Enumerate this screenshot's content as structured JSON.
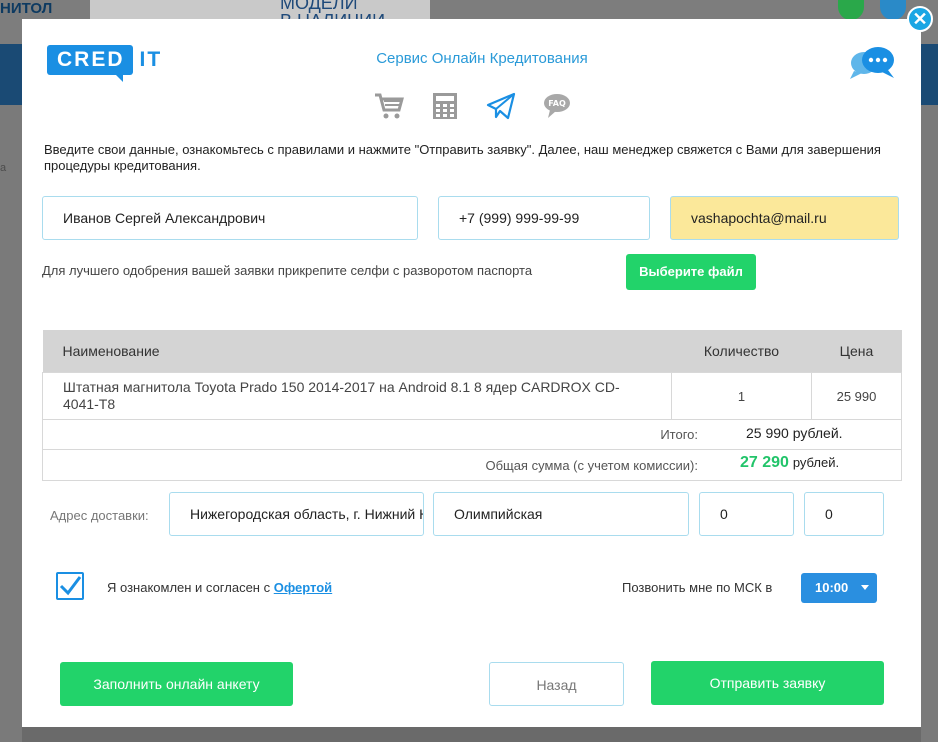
{
  "background": {
    "left_text": "НИТОЛ",
    "banner_text_line1": "МОДЕЛИ",
    "banner_text_line2": "В НАЛИЧИИ",
    "side_text": "а"
  },
  "modal": {
    "logo_part1": "CRED",
    "logo_part2": "IT",
    "title": "Сервис Онлайн Кредитования",
    "intro": "Введите свои данные, ознакомьтесь с правилами и нажмите \"Отправить заявку\". Далее, наш менеджер свяжется с Вами для завершения процедуры кредитования.",
    "fields": {
      "full_name": "Иванов Сергей Александрович",
      "phone": "+7 (999) 999-99-99",
      "email": "vashapochta@mail.ru"
    },
    "selfie_text": "Для лучшего одобрения вашей заявки прикрепите селфи с разворотом паспорта",
    "file_button": "Выберите файл",
    "table": {
      "headers": {
        "name": "Наименование",
        "qty": "Количество",
        "price": "Цена"
      },
      "rows": [
        {
          "name": "Штатная магнитола Toyota Prado 150 2014-2017 на Android 8.1 8 ядер CARDROX CD-4041-T8",
          "qty": "1",
          "price": "25 990"
        }
      ]
    },
    "totals": {
      "subtotal_label": "Итого:",
      "subtotal_value": "25 990 рублей.",
      "total_label": "Общая сумма (с учетом комиссии):",
      "total_value": "27 290",
      "total_unit": "рублей."
    },
    "address": {
      "label": "Адрес доставки:",
      "region": "Нижегородская область, г. Нижний Новгород",
      "street": "Олимпийская",
      "house": "0",
      "flat": "0"
    },
    "agree": {
      "text": "Я ознакомлен и согласен с",
      "link": "Офертой",
      "checked": true
    },
    "call": {
      "label": "Позвонить мне по МСК в",
      "time": "10:00"
    },
    "buttons": {
      "form": "Заполнить онлайн анкету",
      "back": "Назад",
      "submit": "Отправить заявку"
    },
    "icons": [
      "cart-icon",
      "calculator-icon",
      "paper-plane-icon",
      "faq-icon",
      "chat-bubbles-icon",
      "close-icon",
      "checkmark-icon"
    ],
    "colors": {
      "accent": "#1a8fe3",
      "green": "#22d36a",
      "yellow_field": "#fbe89a"
    }
  }
}
